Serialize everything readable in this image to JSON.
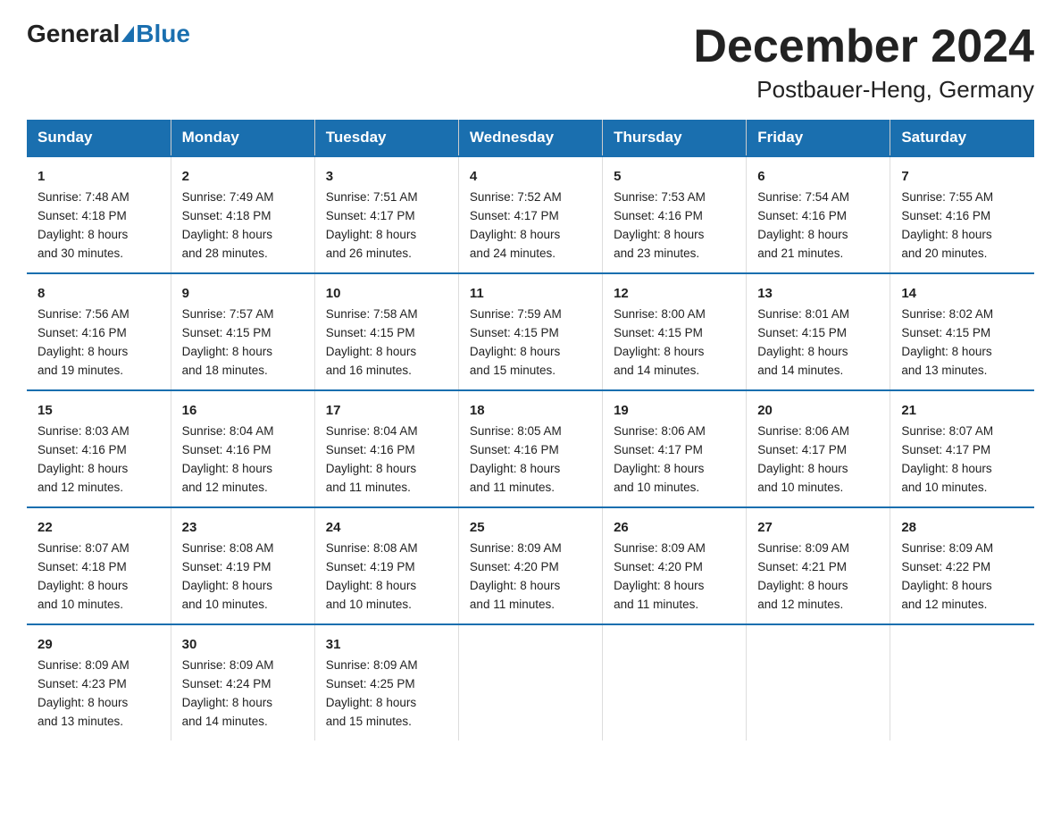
{
  "logo": {
    "general": "General",
    "blue": "Blue"
  },
  "title": "December 2024",
  "subtitle": "Postbauer-Heng, Germany",
  "weekdays": [
    "Sunday",
    "Monday",
    "Tuesday",
    "Wednesday",
    "Thursday",
    "Friday",
    "Saturday"
  ],
  "weeks": [
    [
      {
        "day": "1",
        "sunrise": "7:48 AM",
        "sunset": "4:18 PM",
        "daylight": "8 hours and 30 minutes."
      },
      {
        "day": "2",
        "sunrise": "7:49 AM",
        "sunset": "4:18 PM",
        "daylight": "8 hours and 28 minutes."
      },
      {
        "day": "3",
        "sunrise": "7:51 AM",
        "sunset": "4:17 PM",
        "daylight": "8 hours and 26 minutes."
      },
      {
        "day": "4",
        "sunrise": "7:52 AM",
        "sunset": "4:17 PM",
        "daylight": "8 hours and 24 minutes."
      },
      {
        "day": "5",
        "sunrise": "7:53 AM",
        "sunset": "4:16 PM",
        "daylight": "8 hours and 23 minutes."
      },
      {
        "day": "6",
        "sunrise": "7:54 AM",
        "sunset": "4:16 PM",
        "daylight": "8 hours and 21 minutes."
      },
      {
        "day": "7",
        "sunrise": "7:55 AM",
        "sunset": "4:16 PM",
        "daylight": "8 hours and 20 minutes."
      }
    ],
    [
      {
        "day": "8",
        "sunrise": "7:56 AM",
        "sunset": "4:16 PM",
        "daylight": "8 hours and 19 minutes."
      },
      {
        "day": "9",
        "sunrise": "7:57 AM",
        "sunset": "4:15 PM",
        "daylight": "8 hours and 18 minutes."
      },
      {
        "day": "10",
        "sunrise": "7:58 AM",
        "sunset": "4:15 PM",
        "daylight": "8 hours and 16 minutes."
      },
      {
        "day": "11",
        "sunrise": "7:59 AM",
        "sunset": "4:15 PM",
        "daylight": "8 hours and 15 minutes."
      },
      {
        "day": "12",
        "sunrise": "8:00 AM",
        "sunset": "4:15 PM",
        "daylight": "8 hours and 14 minutes."
      },
      {
        "day": "13",
        "sunrise": "8:01 AM",
        "sunset": "4:15 PM",
        "daylight": "8 hours and 14 minutes."
      },
      {
        "day": "14",
        "sunrise": "8:02 AM",
        "sunset": "4:15 PM",
        "daylight": "8 hours and 13 minutes."
      }
    ],
    [
      {
        "day": "15",
        "sunrise": "8:03 AM",
        "sunset": "4:16 PM",
        "daylight": "8 hours and 12 minutes."
      },
      {
        "day": "16",
        "sunrise": "8:04 AM",
        "sunset": "4:16 PM",
        "daylight": "8 hours and 12 minutes."
      },
      {
        "day": "17",
        "sunrise": "8:04 AM",
        "sunset": "4:16 PM",
        "daylight": "8 hours and 11 minutes."
      },
      {
        "day": "18",
        "sunrise": "8:05 AM",
        "sunset": "4:16 PM",
        "daylight": "8 hours and 11 minutes."
      },
      {
        "day": "19",
        "sunrise": "8:06 AM",
        "sunset": "4:17 PM",
        "daylight": "8 hours and 10 minutes."
      },
      {
        "day": "20",
        "sunrise": "8:06 AM",
        "sunset": "4:17 PM",
        "daylight": "8 hours and 10 minutes."
      },
      {
        "day": "21",
        "sunrise": "8:07 AM",
        "sunset": "4:17 PM",
        "daylight": "8 hours and 10 minutes."
      }
    ],
    [
      {
        "day": "22",
        "sunrise": "8:07 AM",
        "sunset": "4:18 PM",
        "daylight": "8 hours and 10 minutes."
      },
      {
        "day": "23",
        "sunrise": "8:08 AM",
        "sunset": "4:19 PM",
        "daylight": "8 hours and 10 minutes."
      },
      {
        "day": "24",
        "sunrise": "8:08 AM",
        "sunset": "4:19 PM",
        "daylight": "8 hours and 10 minutes."
      },
      {
        "day": "25",
        "sunrise": "8:09 AM",
        "sunset": "4:20 PM",
        "daylight": "8 hours and 11 minutes."
      },
      {
        "day": "26",
        "sunrise": "8:09 AM",
        "sunset": "4:20 PM",
        "daylight": "8 hours and 11 minutes."
      },
      {
        "day": "27",
        "sunrise": "8:09 AM",
        "sunset": "4:21 PM",
        "daylight": "8 hours and 12 minutes."
      },
      {
        "day": "28",
        "sunrise": "8:09 AM",
        "sunset": "4:22 PM",
        "daylight": "8 hours and 12 minutes."
      }
    ],
    [
      {
        "day": "29",
        "sunrise": "8:09 AM",
        "sunset": "4:23 PM",
        "daylight": "8 hours and 13 minutes."
      },
      {
        "day": "30",
        "sunrise": "8:09 AM",
        "sunset": "4:24 PM",
        "daylight": "8 hours and 14 minutes."
      },
      {
        "day": "31",
        "sunrise": "8:09 AM",
        "sunset": "4:25 PM",
        "daylight": "8 hours and 15 minutes."
      },
      null,
      null,
      null,
      null
    ]
  ],
  "labels": {
    "sunrise": "Sunrise:",
    "sunset": "Sunset:",
    "daylight": "Daylight:"
  }
}
